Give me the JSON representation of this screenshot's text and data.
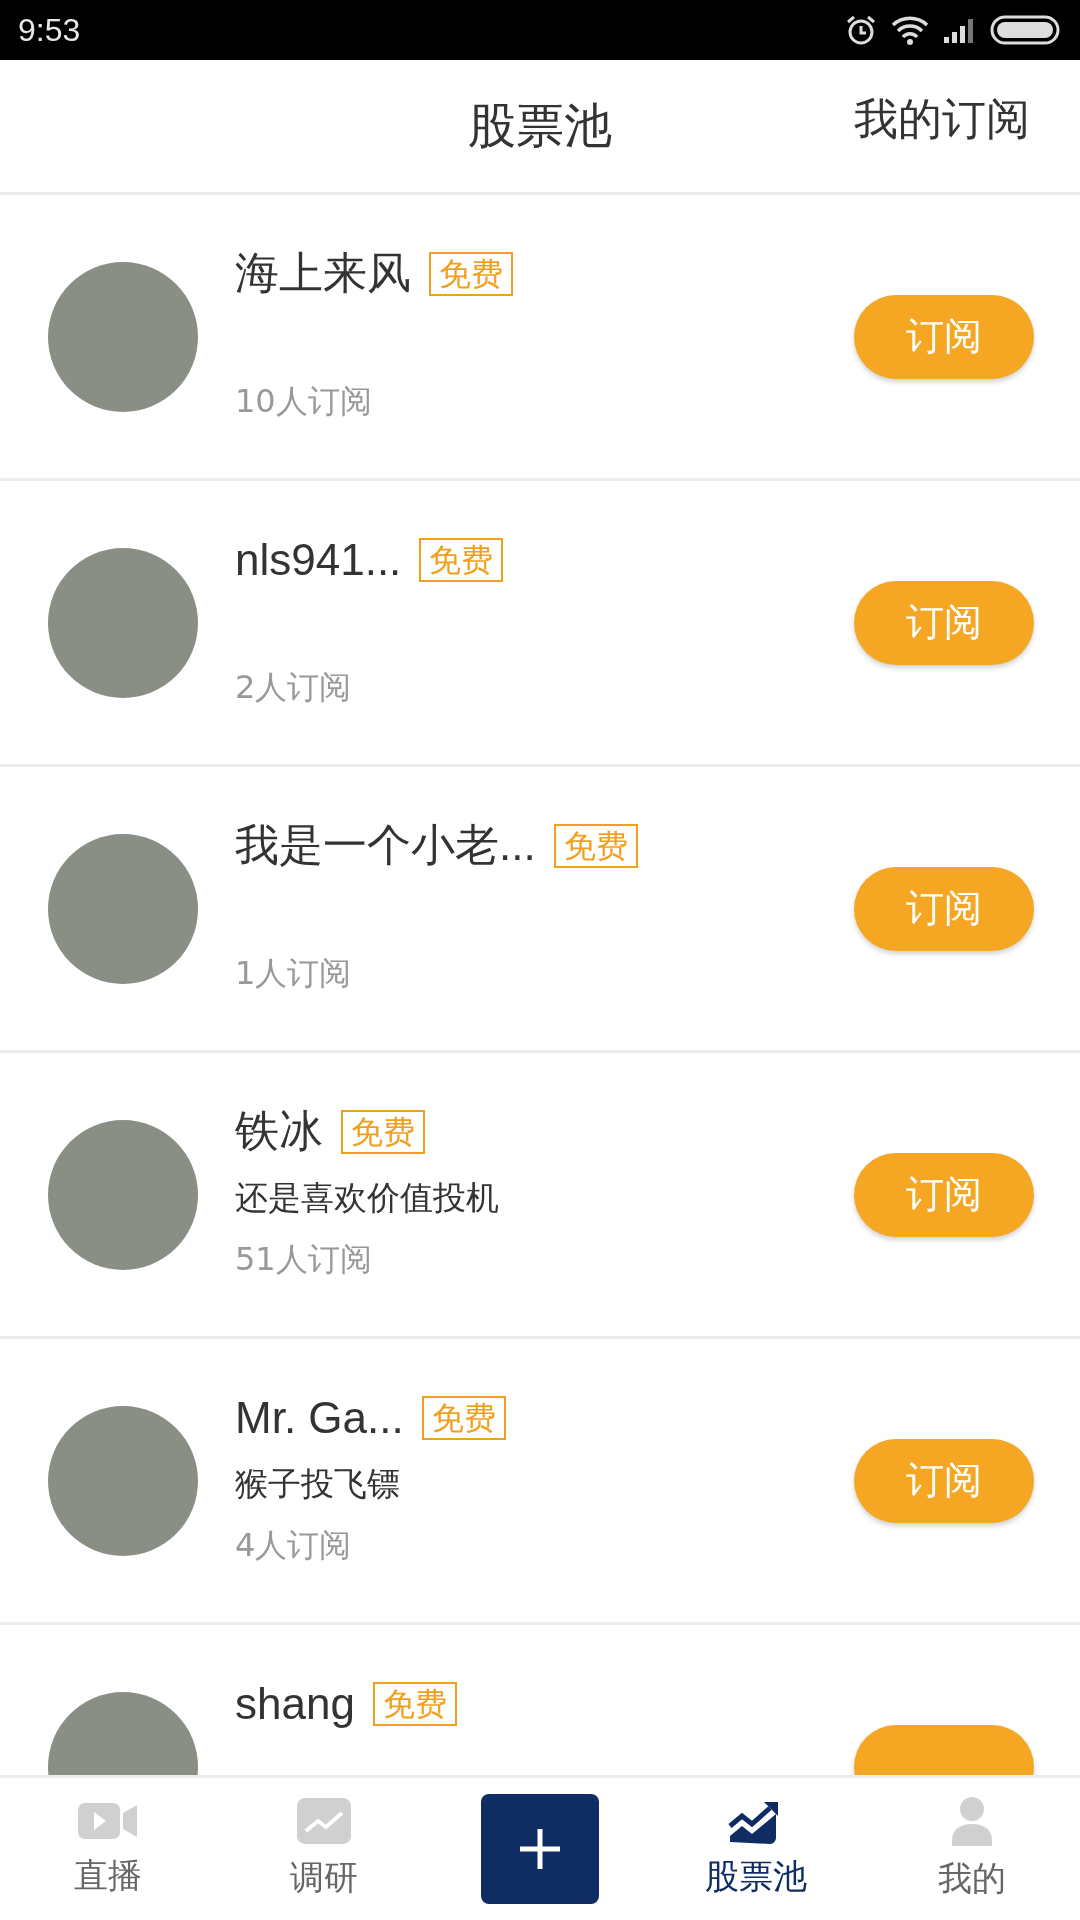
{
  "status_bar": {
    "time": "9:53"
  },
  "header": {
    "title": "股票池",
    "action": "我的订阅"
  },
  "pools": [
    {
      "name": "海上来风",
      "badge": "免费",
      "subscribers": "10人订阅",
      "button": "订阅"
    },
    {
      "name": "nls941...",
      "badge": "免费",
      "subscribers": "2人订阅",
      "button": "订阅"
    },
    {
      "name": "我是一个小老...",
      "badge": "免费",
      "subscribers": "1人订阅",
      "button": "订阅"
    },
    {
      "name": "铁冰",
      "badge": "免费",
      "bio": "还是喜欢价值投机",
      "subscribers": "51人订阅",
      "button": "订阅"
    },
    {
      "name": "Mr. Ga...",
      "badge": "免费",
      "bio": "猴子投飞镖",
      "subscribers": "4人订阅",
      "button": "订阅"
    },
    {
      "name": "shang",
      "badge": "免费"
    }
  ],
  "tab_bar": [
    {
      "kind": "video",
      "label": "直播",
      "selected": false
    },
    {
      "kind": "chart",
      "label": "调研",
      "selected": false
    },
    {
      "kind": "add"
    },
    {
      "kind": "pool",
      "label": "股票池",
      "selected": true
    },
    {
      "kind": "person",
      "label": "我的",
      "selected": false
    }
  ]
}
